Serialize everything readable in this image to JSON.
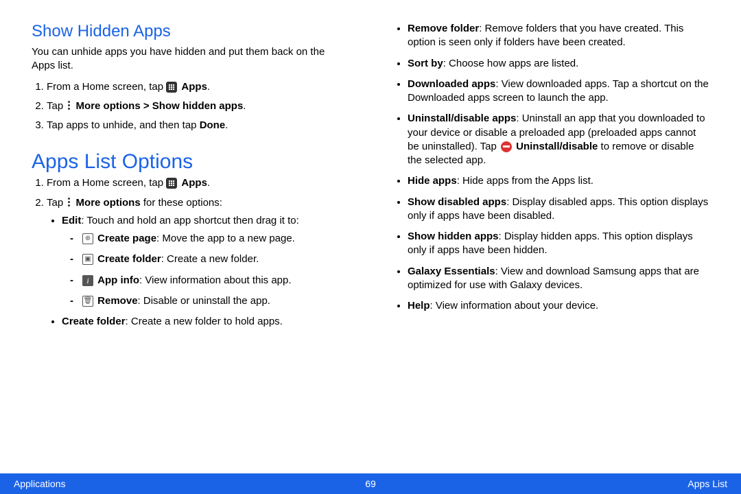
{
  "section1": {
    "heading": "Show Hidden Apps",
    "intro": "You can unhide apps you have hidden and put them back on the Apps list.",
    "steps": {
      "s1_pre": "From a Home screen, tap ",
      "s1_post": "Apps",
      "s2_pre": "Tap ",
      "s2_bold": "More options > Show hidden apps",
      "s3": "Tap apps to unhide, and then tap ",
      "s3_bold": "Done"
    }
  },
  "section2": {
    "heading": "Apps List Options",
    "steps": {
      "s1_pre": "From a Home screen, tap ",
      "s1_post": "Apps",
      "s2_pre": "Tap ",
      "s2_bold": "More options",
      "s2_post": " for these options:"
    },
    "edit": {
      "label": "Edit",
      "desc": ": Touch and hold an app shortcut then drag it to:",
      "sub": {
        "create_page_label": "Create page",
        "create_page_desc": ": Move the app to a new page.",
        "create_folder_label": "Create folder",
        "create_folder_desc": ": Create a new folder.",
        "app_info_label": "App info",
        "app_info_desc": ": View information about this app.",
        "remove_label": "Remove",
        "remove_desc": ": Disable or uninstall the app."
      }
    },
    "create_folder2_label": "Create folder",
    "create_folder2_desc": ": Create a new folder to hold apps."
  },
  "right": {
    "remove_folder_label": "Remove folder",
    "remove_folder_desc": ": Remove folders that you have created. This option is seen only if folders have been created.",
    "sort_by_label": "Sort by",
    "sort_by_desc": ": Choose how apps are listed.",
    "downloaded_label": "Downloaded apps",
    "downloaded_desc": ": View downloaded apps. Tap a shortcut on the Downloaded apps screen to launch the app.",
    "uninstall_label": "Uninstall/disable apps",
    "uninstall_desc1": ": Uninstall an app that you downloaded to your device or disable a preloaded app (preloaded apps cannot be uninstalled). Tap ",
    "uninstall_bold": "Uninstall/disable",
    "uninstall_desc2": " to remove or disable the selected app.",
    "hide_apps_label": "Hide apps",
    "hide_apps_desc": ": Hide apps from the Apps list.",
    "show_disabled_label": "Show disabled apps",
    "show_disabled_desc": ": Display disabled apps. This option displays only if apps have been disabled.",
    "show_hidden_label": "Show hidden apps",
    "show_hidden_desc": ": Display hidden apps. This option displays only if apps have been hidden.",
    "galaxy_label": "Galaxy Essentials",
    "galaxy_desc": ": View and download Samsung apps that are optimized for use with Galaxy devices.",
    "help_label": "Help",
    "help_desc": ": View information about your device."
  },
  "footer": {
    "left": "Applications",
    "center": "69",
    "right": "Apps List"
  }
}
